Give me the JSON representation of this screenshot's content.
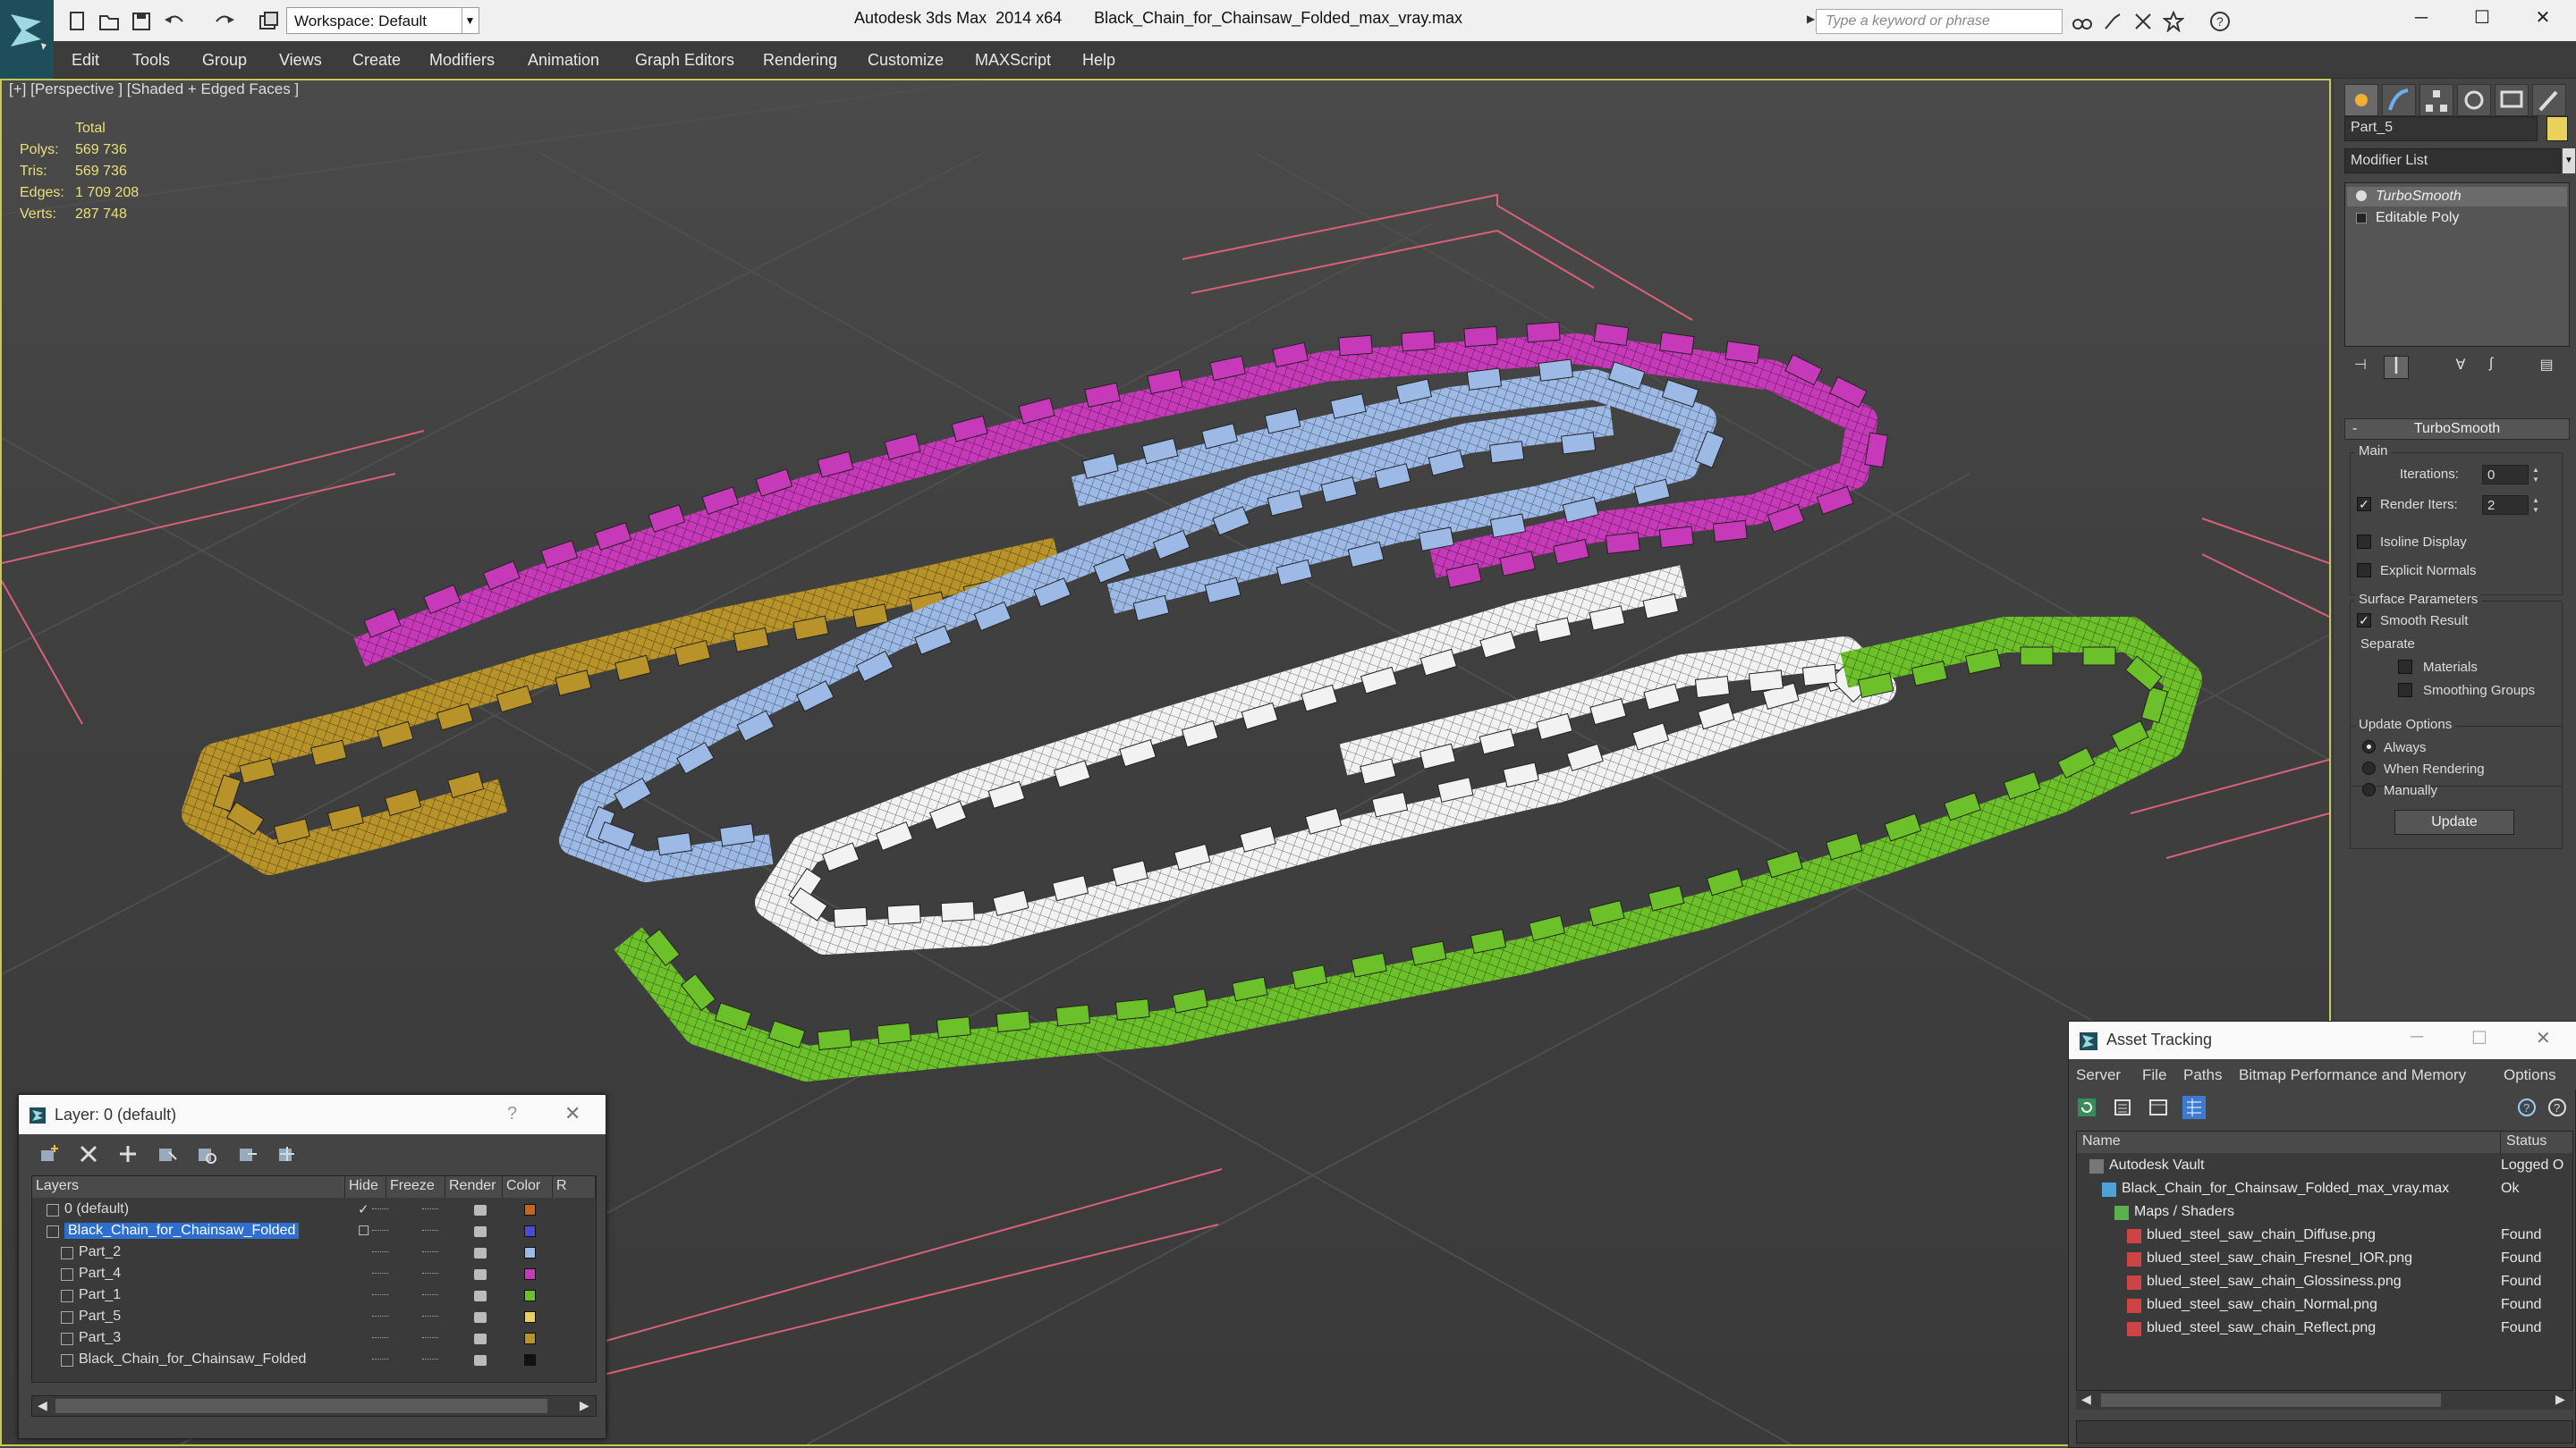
{
  "app": {
    "title": "Autodesk 3ds Max  2014 x64",
    "file": "Black_Chain_for_Chainsaw_Folded_max_vray.max",
    "workspace": "Workspace: Default",
    "search_placeholder": "Type a keyword or phrase"
  },
  "menu": [
    "Edit",
    "Tools",
    "Group",
    "Views",
    "Create",
    "Modifiers",
    "Animation",
    "Graph Editors",
    "Rendering",
    "Customize",
    "MAXScript",
    "Help"
  ],
  "viewport": {
    "label": "[+] [Perspective ] [Shaded + Edged Faces ]",
    "stats": {
      "header": "Total",
      "rows": [
        {
          "label": "Polys:",
          "value": "569 736"
        },
        {
          "label": "Tris:",
          "value": "569 736"
        },
        {
          "label": "Edges:",
          "value": "1 709 208"
        },
        {
          "label": "Verts:",
          "value": "287 748"
        }
      ]
    },
    "chain_colors": {
      "magenta": "#c639b8",
      "gold": "#b8932a",
      "lightblue": "#9db9e6",
      "white": "#f2f2f2",
      "green": "#6cc02a"
    }
  },
  "command_panel": {
    "object_name": "Part_5",
    "object_color": "#e8d25c",
    "modifier_list": "Modifier List",
    "stack": [
      "TurboSmooth",
      "Editable Poly"
    ],
    "rollout_title": "TurboSmooth",
    "main_group": "Main",
    "iterations_label": "Iterations:",
    "iterations_value": "0",
    "render_iters_label": "Render Iters:",
    "render_iters_value": "2",
    "isoline_label": "Isoline Display",
    "explicit_normals_label": "Explicit Normals",
    "surface_group": "Surface Parameters",
    "smooth_result_label": "Smooth Result",
    "separate_label": "Separate",
    "materials_label": "Materials",
    "smoothing_groups_label": "Smoothing Groups",
    "update_group": "Update Options",
    "always_label": "Always",
    "when_rendering_label": "When Rendering",
    "manually_label": "Manually",
    "update_button": "Update"
  },
  "layer_dialog": {
    "title": "Layer: 0 (default)",
    "help": "?",
    "columns": [
      "Layers",
      "Hide",
      "Freeze",
      "Render",
      "Color",
      "R"
    ],
    "rows": [
      {
        "name": "0 (default)",
        "color": "#c8641e",
        "level": 0
      },
      {
        "name": "Black_Chain_for_Chainsaw_Folded",
        "color": "#4b4bd6",
        "level": 0,
        "selected": true
      },
      {
        "name": "Part_2",
        "color": "#9db9e6",
        "level": 1
      },
      {
        "name": "Part_4",
        "color": "#c639b8",
        "level": 1
      },
      {
        "name": "Part_1",
        "color": "#6cc02a",
        "level": 1
      },
      {
        "name": "Part_5",
        "color": "#e8d25c",
        "level": 1
      },
      {
        "name": "Part_3",
        "color": "#b8932a",
        "level": 1
      },
      {
        "name": "Black_Chain_for_Chainsaw_Folded",
        "color": "#111111",
        "level": 1
      }
    ]
  },
  "asset_dialog": {
    "title": "Asset Tracking",
    "menu": [
      "Server",
      "File",
      "Paths",
      "Bitmap Performance and Memory",
      "Options"
    ],
    "columns": [
      "Name",
      "Status"
    ],
    "rows": [
      {
        "name": "Autodesk Vault",
        "status": "Logged O",
        "level": 0
      },
      {
        "name": "Black_Chain_for_Chainsaw_Folded_max_vray.max",
        "status": "Ok",
        "level": 1
      },
      {
        "name": "Maps / Shaders",
        "status": "",
        "level": 2
      },
      {
        "name": "blued_steel_saw_chain_Diffuse.png",
        "status": "Found",
        "level": 3
      },
      {
        "name": "blued_steel_saw_chain_Fresnel_IOR.png",
        "status": "Found",
        "level": 3
      },
      {
        "name": "blued_steel_saw_chain_Glossiness.png",
        "status": "Found",
        "level": 3
      },
      {
        "name": "blued_steel_saw_chain_Normal.png",
        "status": "Found",
        "level": 3
      },
      {
        "name": "blued_steel_saw_chain_Reflect.png",
        "status": "Found",
        "level": 3
      }
    ]
  }
}
